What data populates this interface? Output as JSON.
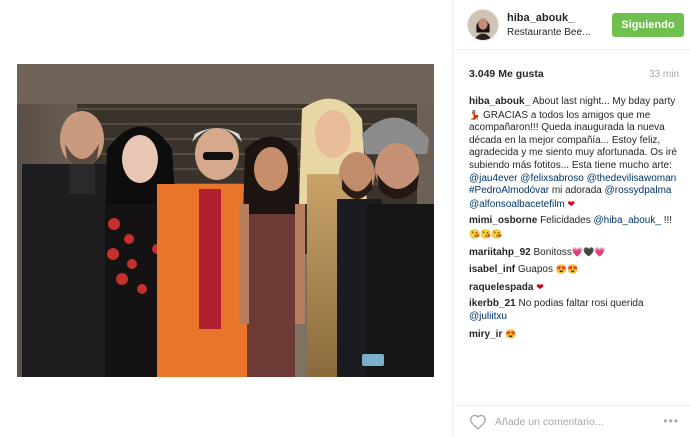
{
  "post": {
    "username": "hiba_abouk_",
    "location": "Restaurante Bee...",
    "follow_label": "Siguiendo",
    "likes": "3.049 Me gusta",
    "time": "33 min"
  },
  "caption": {
    "author": "hiba_abouk_",
    "text1": " About last night... My bday party ",
    "emoji1": "💃",
    "text2": " GRACIAS a todos los amigos que me acompañaron!!! Queda inaugurada la nueva década en la mejor compañía... Estoy feliz, agradecida y me siento muy afortunada. Os iré subiendo más fotitos... Esta tiene mucho arte: ",
    "mention1": "@jau4ever",
    "mention2": "@felixsabroso",
    "mention3": "@thedevilisawoman",
    "hashtag1": "#PedroAlmodóvar",
    "text3": " mi adorada ",
    "mention4": "@rossydpalma",
    "mention5": "@alfonsoalbacetefilm",
    "emoji2": "❤"
  },
  "comments": [
    {
      "author": "mimi_osborne",
      "text": " Felicidades ",
      "mention": "@hiba_abouk_",
      "tail": " !!! ",
      "emoji": "😘😘😘"
    },
    {
      "author": "mariitahp_92",
      "text": " Bonitoss",
      "emoji": "💗🖤💗"
    },
    {
      "author": "isabel_inf",
      "text": " Guapos ",
      "emoji": "😍😍"
    },
    {
      "author": "raquelespada",
      "text": " ",
      "emoji": "❤"
    },
    {
      "author": "ikerbb_21",
      "text": " No podias faltar rosi querida ",
      "mention": "@juliitxu"
    },
    {
      "author": "miry_ir",
      "text": " ",
      "emoji": "😍"
    }
  ],
  "add_comment": {
    "placeholder": "Añade un comentario..."
  },
  "icons": {
    "heart": "heart-outline-icon",
    "more": "more-dots-icon"
  },
  "colors": {
    "follow_button": "#70c050",
    "link": "#003569",
    "muted": "#a5a7aa"
  }
}
